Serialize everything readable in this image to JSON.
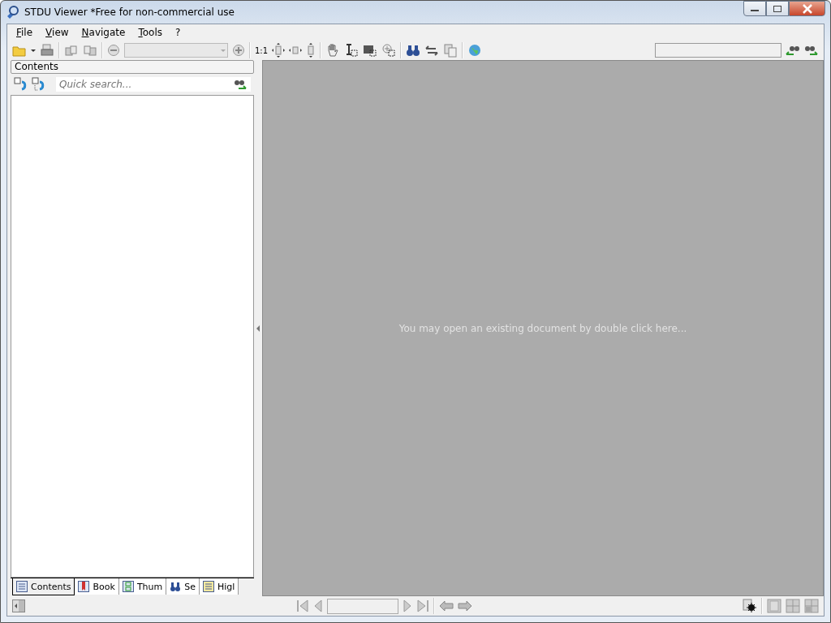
{
  "window": {
    "title": "STDU Viewer *Free for non-commercial use"
  },
  "menu": [
    {
      "label": "File"
    },
    {
      "label": "View"
    },
    {
      "label": "Navigate"
    },
    {
      "label": "Tools"
    },
    {
      "label": "?"
    }
  ],
  "toolbar": {
    "actual_size_label": "1:1"
  },
  "sidebar": {
    "header": "Contents",
    "search": {
      "placeholder": "Quick search..."
    },
    "tabs": [
      {
        "label": "Contents",
        "selected": true
      },
      {
        "label": "Book",
        "selected": false
      },
      {
        "label": "Thum",
        "selected": false
      },
      {
        "label": "Se",
        "selected": false
      },
      {
        "label": "Higl",
        "selected": false
      }
    ]
  },
  "document": {
    "hint": "You may open an existing document by double click here..."
  }
}
